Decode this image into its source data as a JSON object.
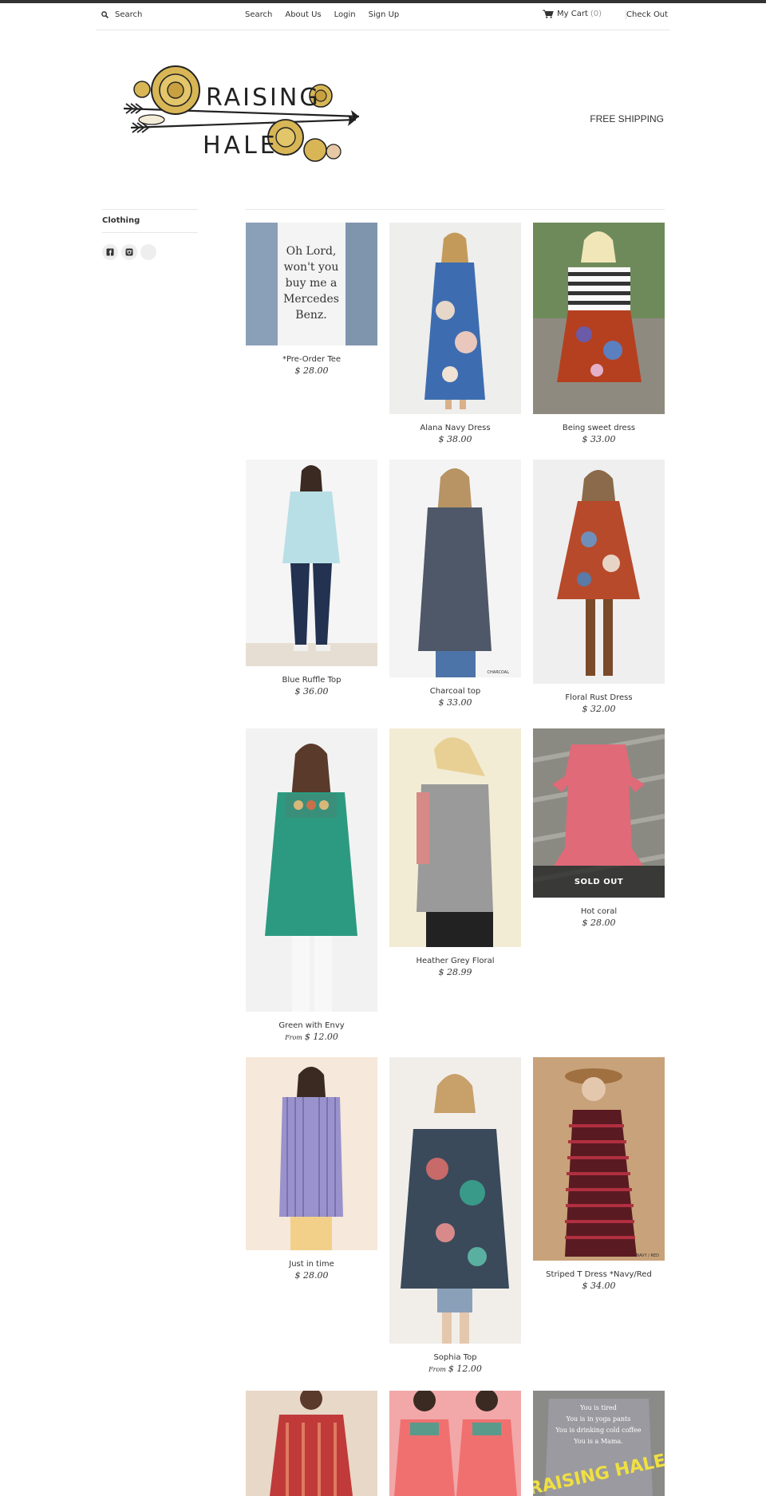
{
  "nav": {
    "search_label": "Search",
    "links": [
      "Search",
      "About Us",
      "Login",
      "Sign Up"
    ],
    "cart_label": "My Cart",
    "cart_count": "(0)",
    "checkout_label": "Check Out"
  },
  "header": {
    "logo_text": "RAISING HALE",
    "shipping": "FREE SHIPPING"
  },
  "sidebar": {
    "category": "Clothing"
  },
  "products": [
    {
      "name": "*Pre-Order Tee",
      "price": "$ 28.00"
    },
    {
      "name": "Alana Navy Dress",
      "price": "$ 38.00"
    },
    {
      "name": "Being sweet dress",
      "price": "$ 33.00"
    },
    {
      "name": "Blue Ruffle Top",
      "price": "$ 36.00"
    },
    {
      "name": "Charcoal top",
      "price": "$ 33.00"
    },
    {
      "name": "Floral Rust Dress",
      "price": "$ 32.00"
    },
    {
      "name": "Green with Envy",
      "price_prefix": "From",
      "price": "$ 12.00"
    },
    {
      "name": "Heather Grey Floral",
      "price": "$ 28.99"
    },
    {
      "name": "Hot coral",
      "price": "$ 28.00",
      "badge": "SOLD OUT"
    },
    {
      "name": "Just in time",
      "price": "$ 28.00"
    },
    {
      "name": "Sophia Top",
      "price_prefix": "From",
      "price": "$ 12.00"
    },
    {
      "name": "Striped T Dress *Navy/Red",
      "price": "$ 34.00"
    }
  ]
}
